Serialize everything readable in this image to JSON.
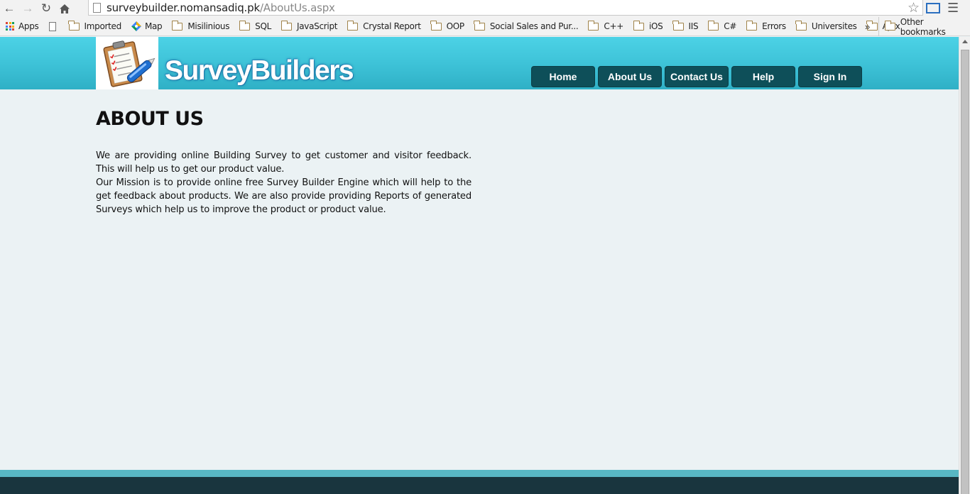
{
  "browser": {
    "url_host": "surveybuilder.nomansadiq.pk",
    "url_path": "/AboutUs.aspx",
    "icons": [
      "back-icon",
      "forward-icon",
      "reload-icon",
      "home-icon",
      "star-icon",
      "cast-icon",
      "menu-icon"
    ]
  },
  "bookmarks": {
    "items": [
      {
        "label": "Apps",
        "icon": "apps-icon"
      },
      {
        "label": "",
        "icon": "page-icon"
      },
      {
        "label": "Imported",
        "icon": "folder-icon"
      },
      {
        "label": "Map",
        "icon": "maps-icon"
      },
      {
        "label": "Misilinious",
        "icon": "folder-icon"
      },
      {
        "label": "SQL",
        "icon": "folder-icon"
      },
      {
        "label": "JavaScript",
        "icon": "folder-icon"
      },
      {
        "label": "Crystal Report",
        "icon": "folder-icon"
      },
      {
        "label": "OOP",
        "icon": "folder-icon"
      },
      {
        "label": "Social Sales and Pur...",
        "icon": "folder-icon"
      },
      {
        "label": "C++",
        "icon": "folder-icon"
      },
      {
        "label": "iOS",
        "icon": "folder-icon"
      },
      {
        "label": "IIS",
        "icon": "folder-icon"
      },
      {
        "label": "C#",
        "icon": "folder-icon"
      },
      {
        "label": "Errors",
        "icon": "folder-icon"
      },
      {
        "label": "Universites",
        "icon": "folder-icon"
      },
      {
        "label": "Ajax",
        "icon": "folder-icon"
      }
    ],
    "overflow": "»",
    "other": "Other bookmarks"
  },
  "site": {
    "logo_text": "SurveyBuilders",
    "menu": [
      "Home",
      "About Us",
      "Contact Us",
      "Help",
      "Sign In"
    ],
    "colors": {
      "header": "#3ec3d8",
      "menu": "#0e4f59",
      "footer": "#19353e",
      "footer_band": "#58b7c4",
      "background": "#ebf2f4"
    }
  },
  "content": {
    "heading": "ABOUT US",
    "paragraphs": [
      "We are providing online Building Survey to get customer and visitor feedback. This will help us to get our product value.",
      "Our Mission is to provide online free Survey Builder Engine which will help to the get feedback about products. We are also provide providing Reports of generated Surveys which help us to improve the product or product value."
    ]
  }
}
